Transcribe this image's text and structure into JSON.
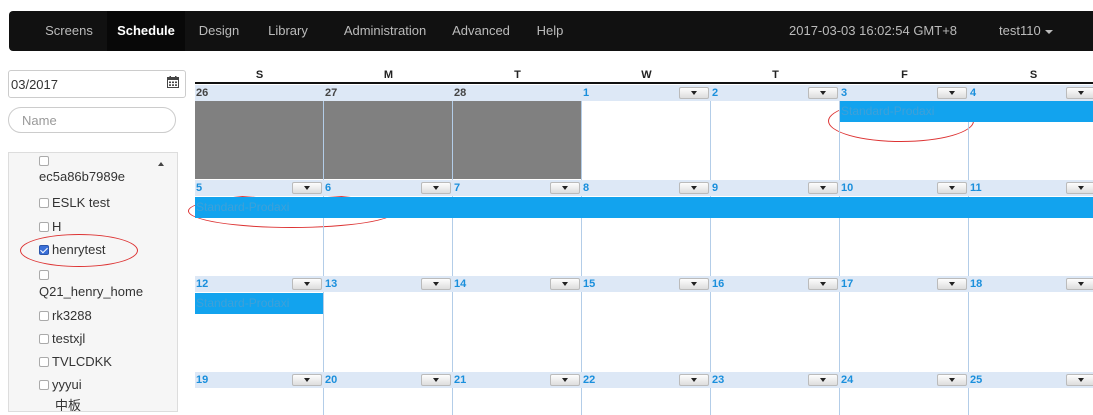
{
  "nav": {
    "items": [
      {
        "label": "Screens",
        "active": false
      },
      {
        "label": "Schedule",
        "active": true
      },
      {
        "label": "Design",
        "active": false
      },
      {
        "label": "Library",
        "active": false
      },
      {
        "label": "Administration",
        "active": false
      },
      {
        "label": "Advanced",
        "active": false
      },
      {
        "label": "Help",
        "active": false
      }
    ],
    "datetime": "2017-03-03 16:02:54 GMT+8",
    "user": "test110"
  },
  "sidebar": {
    "month_value": "03/2017",
    "name_placeholder": "Name",
    "players": [
      {
        "label": "ec5a86b7989e",
        "checked": false
      },
      {
        "label": "ESLK test",
        "checked": false
      },
      {
        "label": "H",
        "checked": false
      },
      {
        "label": "henrytest",
        "checked": true
      },
      {
        "label": "Q21_henry_home",
        "checked": false
      },
      {
        "label": "rk3288",
        "checked": false
      },
      {
        "label": "testxjl",
        "checked": false
      },
      {
        "label": "TVLCDKK",
        "checked": false
      },
      {
        "label": "yyyui",
        "checked": false
      },
      {
        "label": "中板",
        "checked": false
      }
    ]
  },
  "calendar": {
    "weekdays": [
      "S",
      "M",
      "T",
      "W",
      "T",
      "F",
      "S"
    ],
    "weeks": [
      [
        "26",
        "27",
        "28",
        "1",
        "2",
        "3",
        "4"
      ],
      [
        "5",
        "6",
        "7",
        "8",
        "9",
        "10",
        "11"
      ],
      [
        "12",
        "13",
        "14",
        "15",
        "16",
        "17",
        "18"
      ],
      [
        "19",
        "20",
        "21",
        "22",
        "23",
        "24",
        "25"
      ]
    ],
    "event_label": "Standard-Prodaxi",
    "event_color": "#12a3ee",
    "other_month_color": "#808080"
  }
}
